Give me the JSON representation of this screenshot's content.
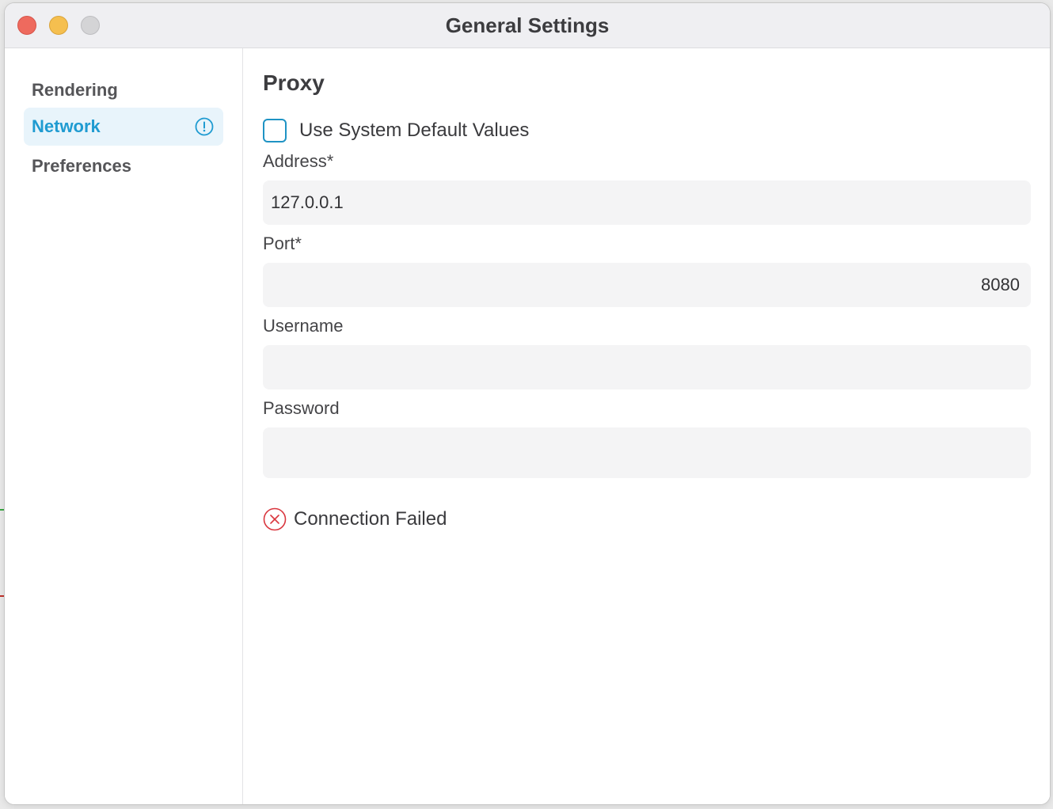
{
  "window": {
    "title": "General Settings"
  },
  "sidebar": {
    "items": [
      {
        "label": "Rendering",
        "active": false
      },
      {
        "label": "Network",
        "active": true,
        "badge_icon": "exclamation-circle-icon"
      },
      {
        "label": "Preferences",
        "active": false
      }
    ]
  },
  "proxy": {
    "title": "Proxy",
    "use_system_defaults": {
      "label": "Use System Default Values",
      "checked": false
    },
    "fields": {
      "address": {
        "label": "Address*",
        "value": "127.0.0.1"
      },
      "port": {
        "label": "Port*",
        "value": "8080"
      },
      "username": {
        "label": "Username",
        "value": ""
      },
      "password": {
        "label": "Password",
        "value": ""
      }
    },
    "status": {
      "icon": "x-circle-icon",
      "text": "Connection Failed",
      "color": "#d9363e"
    }
  },
  "colors": {
    "accent": "#1f9bd1",
    "active_bg": "#e8f4fb",
    "error": "#d9363e"
  }
}
